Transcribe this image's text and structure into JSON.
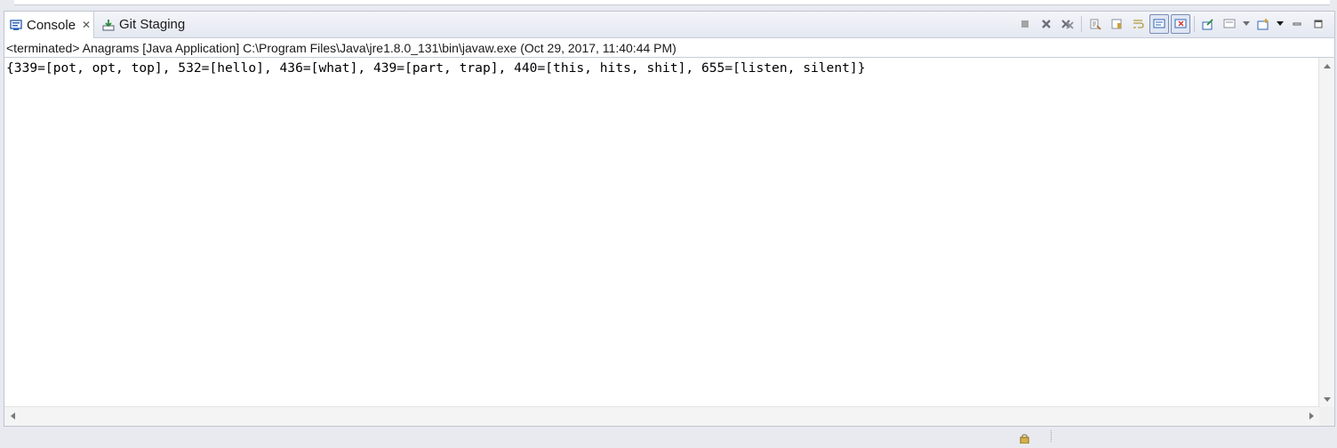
{
  "tabs": [
    {
      "label": "Console",
      "icon": "console-icon",
      "active": true
    },
    {
      "label": "Git Staging",
      "icon": "git-staging-icon",
      "active": false
    }
  ],
  "toolbar": {
    "icons": [
      "terminate-icon",
      "remove-launch-icon",
      "remove-all-terminated-icon",
      "clear-console-icon",
      "scroll-lock-icon",
      "word-wrap-icon",
      "show-on-stdout-icon",
      "show-on-stderr-icon",
      "pin-console-icon",
      "display-selected-console-icon",
      "open-console-icon",
      "minimize-icon",
      "maximize-icon"
    ]
  },
  "console": {
    "status": "<terminated> Anagrams [Java Application] C:\\Program Files\\Java\\jre1.8.0_131\\bin\\javaw.exe (Oct 29, 2017, 11:40:44 PM)",
    "output": "{339=[pot, opt, top], 532=[hello], 436=[what], 439=[part, trap], 440=[this, hits, shit], 655=[listen, silent]}"
  },
  "colors": {
    "accent": "#2f63b5",
    "terminate_disabled": "#9a9a9a"
  }
}
